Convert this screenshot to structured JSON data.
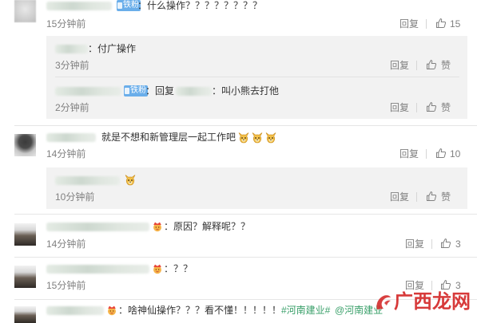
{
  "comments": [
    {
      "badge": "铁粉",
      "text": "：什么操作？？？？？？？？",
      "time": "15分钟前",
      "reply_label": "回复",
      "likes": "15",
      "replies": [
        {
          "text": "：付广操作",
          "time": "3分钟前",
          "reply_label": "回复",
          "like_label": "赞"
        },
        {
          "badge": "铁粉",
          "text_prefix": "：回复",
          "text": "：叫小熊去打他",
          "time": "2分钟前",
          "reply_label": "回复",
          "like_label": "赞"
        }
      ]
    },
    {
      "text": "就是不想和新管理层一起工作吧",
      "emojis": [
        "doge",
        "doge",
        "doge"
      ],
      "time": "14分钟前",
      "reply_label": "回复",
      "likes": "10",
      "replies": [
        {
          "emojis": [
            "doge"
          ],
          "time": "10分钟前",
          "reply_label": "回复",
          "like_label": "赞"
        }
      ]
    },
    {
      "badge_icon": "fan-badge",
      "text": "：原因？解释呢？？",
      "time": "14分钟前",
      "reply_label": "回复",
      "likes": "3"
    },
    {
      "badge_icon": "fan-badge",
      "text": "：？？",
      "time": "15分钟前",
      "reply_label": "回复",
      "likes": "3"
    },
    {
      "badge_icon": "fan-badge",
      "text": "：啥神仙操作？？？看不懂！！！！！",
      "topic": "#河南建业#",
      "mention": "@河南建业"
    }
  ],
  "watermark": "广西龙网",
  "icons": {
    "like": "thumb-up-icon",
    "emoji": "doge-emoji",
    "badge": "fan-badge-icon",
    "watermark_logo": "watermark-logo-icon"
  },
  "colors": {
    "text": "#333333",
    "muted": "#808080",
    "reply_bg": "#f2f2f2",
    "badge_bg": "#6aaeea",
    "link": "#3aa06a",
    "watermark": "#d42a2a"
  }
}
